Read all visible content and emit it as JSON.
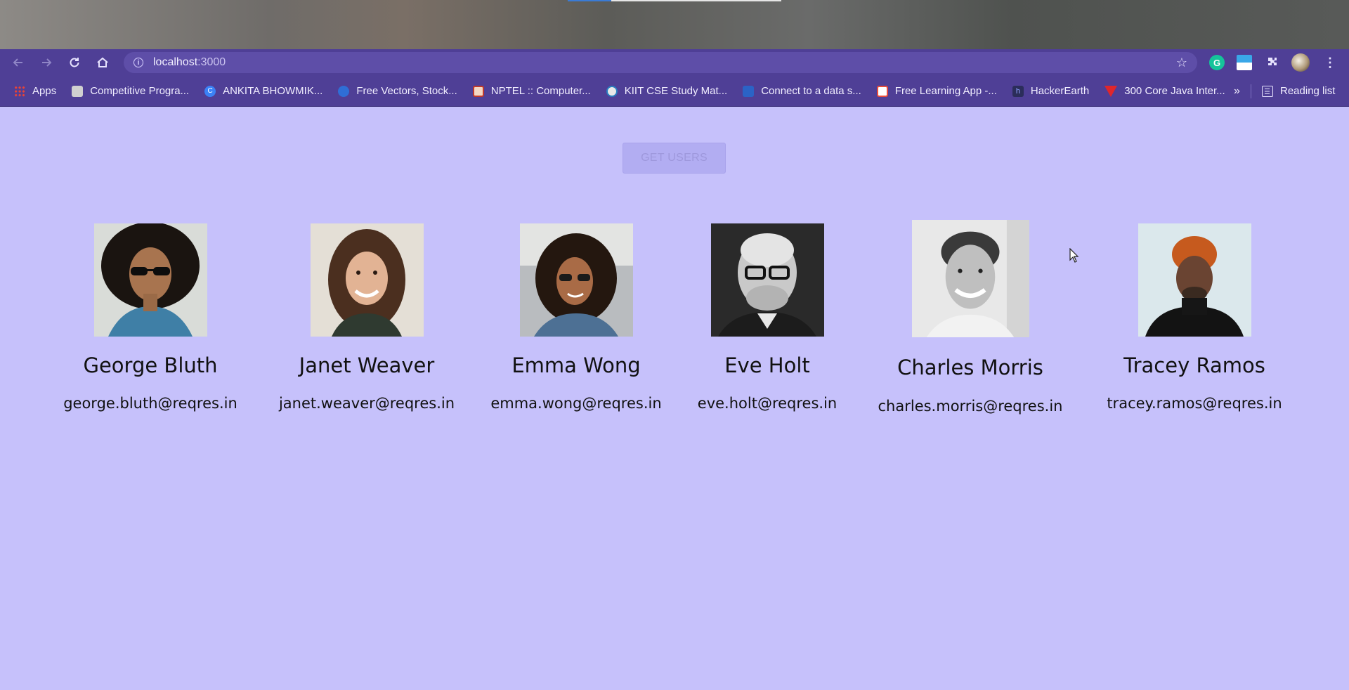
{
  "browser": {
    "url_host": "localhost",
    "url_port": ":3000",
    "extension_g_letter": "G"
  },
  "bookmarks": [
    {
      "label": "Apps",
      "icon": "apps-grid-icon"
    },
    {
      "label": "Competitive Progra...",
      "icon": "trello-icon"
    },
    {
      "label": "ANKITA BHOWMIK...",
      "icon": "c-circle-icon"
    },
    {
      "label": "Free Vectors, Stock...",
      "icon": "freepik-icon"
    },
    {
      "label": "NPTEL :: Computer...",
      "icon": "nptel-icon"
    },
    {
      "label": "KIIT CSE Study Mat...",
      "icon": "wordpress-icon"
    },
    {
      "label": "Connect to a data s...",
      "icon": "play-icon"
    },
    {
      "label": "Free Learning App -...",
      "icon": "free-learning-icon"
    },
    {
      "label": "HackerEarth",
      "icon": "hackerearth-icon"
    },
    {
      "label": "300 Core Java Inter...",
      "icon": "java-icon"
    }
  ],
  "bookmarks_overflow": "»",
  "reading_list": "Reading list",
  "page": {
    "get_users_button": "GET USERS",
    "users": [
      {
        "name": "George Bluth",
        "email": "george.bluth@reqres.in"
      },
      {
        "name": "Janet Weaver",
        "email": "janet.weaver@reqres.in"
      },
      {
        "name": "Emma Wong",
        "email": "emma.wong@reqres.in"
      },
      {
        "name": "Eve Holt",
        "email": "eve.holt@reqres.in"
      },
      {
        "name": "Charles Morris",
        "email": "charles.morris@reqres.in"
      },
      {
        "name": "Tracey Ramos",
        "email": "tracey.ramos@reqres.in"
      }
    ]
  },
  "colors": {
    "page_background": "#c6c1fb",
    "browser_chrome": "#4f3f96",
    "button_background": "#b2adf2"
  }
}
